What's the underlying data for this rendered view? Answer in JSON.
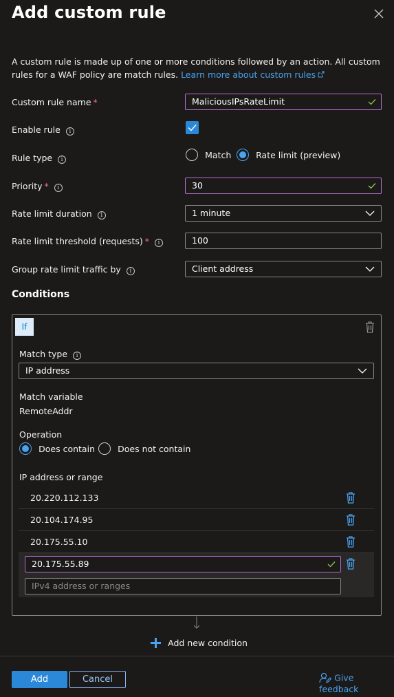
{
  "header": {
    "title": "Add custom rule"
  },
  "description": {
    "text": "A custom rule is made up of one or more conditions followed by an action. All custom rules for a WAF policy are match rules.",
    "link_text": "Learn more about custom rules"
  },
  "form": {
    "rule_name": {
      "label": "Custom rule name",
      "required_mark": "*",
      "value": "MaliciousIPsRateLimit"
    },
    "enable_rule": {
      "label": "Enable rule",
      "checked": true
    },
    "rule_type": {
      "label": "Rule type",
      "options": [
        "Match",
        "Rate limit (preview)"
      ],
      "selected": "Rate limit (preview)"
    },
    "priority": {
      "label": "Priority",
      "required_mark": "*",
      "value": "30"
    },
    "rate_limit_duration": {
      "label": "Rate limit duration",
      "value": "1 minute"
    },
    "rate_limit_threshold": {
      "label": "Rate limit threshold (requests)",
      "required_mark": "*",
      "value": "100"
    },
    "group_by": {
      "label": "Group rate limit traffic by",
      "value": "Client address"
    }
  },
  "conditions": {
    "heading": "Conditions",
    "if_label": "If",
    "match_type": {
      "label": "Match type",
      "value": "IP address"
    },
    "match_variable": {
      "label": "Match variable",
      "value": "RemoteAddr"
    },
    "operation": {
      "label": "Operation",
      "options": [
        "Does contain",
        "Does not contain"
      ],
      "selected": "Does contain"
    },
    "ip_list": {
      "label": "IP address or range",
      "items": [
        "20.220.112.133",
        "20.104.174.95",
        "20.175.55.10"
      ],
      "editing_value": "20.175.55.89",
      "placeholder": "IPv4 address or ranges"
    },
    "add_condition_label": "Add new condition"
  },
  "footer": {
    "add_label": "Add",
    "cancel_label": "Cancel",
    "feedback_label": "Give feedback"
  },
  "colors": {
    "accent": "#4aa3f0",
    "valid_border": "#b86fd6",
    "valid_check": "#92c353",
    "background": "#1b1a19"
  },
  "icons": {
    "close": "close-icon",
    "external": "external-link-icon",
    "info": "info-icon",
    "check": "checkmark-icon",
    "chevron": "chevron-down-icon",
    "trash": "trash-icon",
    "plus": "plus-icon",
    "feedback": "feedback-icon"
  }
}
